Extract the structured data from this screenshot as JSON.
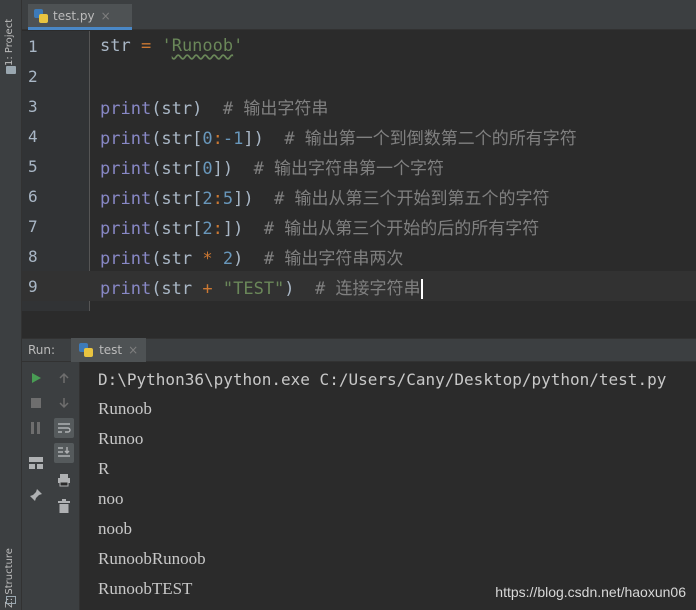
{
  "left_strip": {
    "project_label": "1: Project",
    "structure_label": "Z: Structure"
  },
  "editor_tab": {
    "filename": "test.py",
    "close": "×"
  },
  "editor": {
    "lines": [
      {
        "n": "1"
      },
      {
        "n": "2"
      },
      {
        "n": "3"
      },
      {
        "n": "4"
      },
      {
        "n": "5"
      },
      {
        "n": "6"
      },
      {
        "n": "7"
      },
      {
        "n": "8"
      },
      {
        "n": "9"
      }
    ],
    "current_line": 9
  },
  "run_panel": {
    "label": "Run:",
    "tab_name": "test",
    "tab_close": "×",
    "console_lines": [
      "D:\\Python36\\python.exe C:/Users/Cany/Desktop/python/test.py",
      "Runoob",
      "Runoo",
      "R",
      "noo",
      "noob",
      "RunoobRunoob",
      "RunoobTEST"
    ]
  },
  "watermark": "https://blog.csdn.net/haoxun06",
  "colors": {
    "keyword": "#8888c6",
    "operator": "#cc7832",
    "number": "#6897bb",
    "string": "#6a8759",
    "comment": "#808080",
    "background": "#2b2b2b"
  }
}
